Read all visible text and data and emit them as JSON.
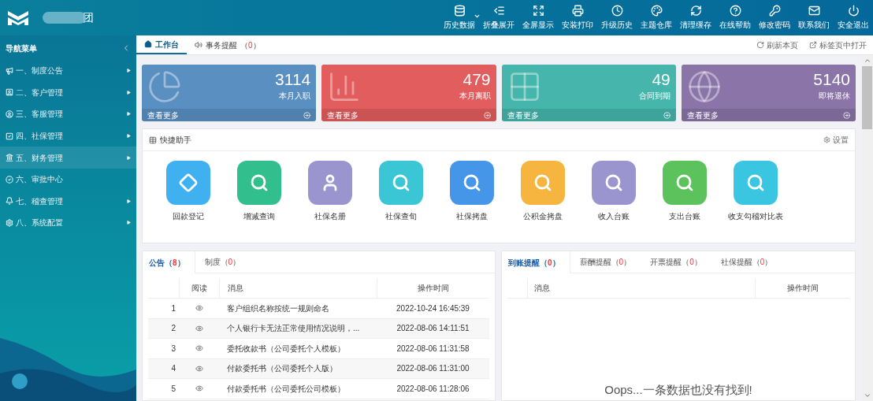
{
  "header": {
    "brand": "团",
    "tools": [
      {
        "label": "历史数据",
        "dropdown": true
      },
      {
        "label": "折叠展开",
        "dropdown": false
      },
      {
        "label": "全屏显示",
        "dropdown": false
      },
      {
        "label": "安装打印",
        "dropdown": false
      },
      {
        "label": "升级历史",
        "dropdown": false
      },
      {
        "label": "主题仓库",
        "dropdown": false
      },
      {
        "label": "清理缓存",
        "dropdown": false
      },
      {
        "label": "在线帮助",
        "dropdown": false
      },
      {
        "label": "修改密码",
        "dropdown": false
      },
      {
        "label": "联系我们",
        "dropdown": false
      },
      {
        "label": "安全退出",
        "dropdown": false
      }
    ]
  },
  "sidebar": {
    "title": "导航菜单",
    "items": [
      {
        "label": "一、制度公告",
        "has_children": true,
        "selected": false
      },
      {
        "label": "二、客户管理",
        "has_children": true,
        "selected": false
      },
      {
        "label": "三、客服管理",
        "has_children": true,
        "selected": false
      },
      {
        "label": "四、社保管理",
        "has_children": true,
        "selected": false
      },
      {
        "label": "五、财务管理",
        "has_children": true,
        "selected": true
      },
      {
        "label": "六、审批中心",
        "has_children": false,
        "selected": false
      },
      {
        "label": "七、稽查管理",
        "has_children": true,
        "selected": false
      },
      {
        "label": "八、系统配置",
        "has_children": true,
        "selected": false
      }
    ]
  },
  "page_tabs": [
    {
      "label": "工作台",
      "selected": true
    },
    {
      "label": "事务提醒",
      "count": "（0）",
      "selected": false
    }
  ],
  "page_actions": [
    "刷新本页",
    "标签页中打开"
  ],
  "stat_cards": [
    {
      "value": "3114",
      "label": "本月入职",
      "link": "查看更多",
      "color": "#5a8fc2"
    },
    {
      "value": "479",
      "label": "本月离职",
      "link": "查看更多",
      "color": "#e25d5d"
    },
    {
      "value": "49",
      "label": "合同到期",
      "link": "查看更多",
      "color": "#46b6ac"
    },
    {
      "value": "5140",
      "label": "即将退休",
      "link": "查看更多",
      "color": "#8a74a8"
    }
  ],
  "quick_panel": {
    "title": "快捷助手",
    "settings": "设置",
    "items": [
      {
        "label": "回款登记",
        "kind": "diamond",
        "color": "#3fb1f1"
      },
      {
        "label": "增减查询",
        "kind": "search",
        "color": "#31bf8d"
      },
      {
        "label": "社保名册",
        "kind": "user",
        "color": "#9b95cf"
      },
      {
        "label": "社保查旬",
        "kind": "search",
        "color": "#3ac6d5"
      },
      {
        "label": "社保拷盘",
        "kind": "search",
        "color": "#4596e8"
      },
      {
        "label": "公积金拷盘",
        "kind": "search",
        "color": "#f5b53f"
      },
      {
        "label": "收入台账",
        "kind": "search",
        "color": "#9b95cf"
      },
      {
        "label": "支出台账",
        "kind": "search",
        "color": "#5cc35c"
      },
      {
        "label": "收支勾稽对比表",
        "kind": "search",
        "color": "#3ac6e0"
      }
    ]
  },
  "notice_panel": {
    "tabs": [
      {
        "label": "公告",
        "count": "（8）",
        "selected": true
      },
      {
        "label": "制度",
        "count": "（0）",
        "selected": false
      }
    ],
    "columns": [
      "阅读",
      "消息",
      "操作时间"
    ],
    "rows": [
      {
        "index": "1",
        "message": "客户组织名称按统一规则命名",
        "time": "2022-10-24 16:45:39"
      },
      {
        "index": "2",
        "message": "个人银行卡无法正常使用情况说明，...",
        "time": "2022-08-06 14:11:51"
      },
      {
        "index": "3",
        "message": "委托收款书（公司委托个人模板）",
        "time": "2022-08-06 11:31:58"
      },
      {
        "index": "4",
        "message": "付款委托书（公司委托个人版）",
        "time": "2022-08-06 11:31:00"
      },
      {
        "index": "5",
        "message": "付款委托书（公司委托公司模板）",
        "time": "2022-08-06 11:28:06"
      }
    ]
  },
  "reminder_panel": {
    "tabs": [
      {
        "label": "到账提醒",
        "count": "（0）",
        "selected": true
      },
      {
        "label": "薪酬提醒",
        "count": "（0）",
        "selected": false
      },
      {
        "label": "开票提醒",
        "count": "（0）",
        "selected": false
      },
      {
        "label": "社保提醒",
        "count": "（0）",
        "selected": false
      }
    ],
    "columns": [
      "消息",
      "操作时间"
    ],
    "empty_text": "Oops...一条数据也没有找到!"
  }
}
